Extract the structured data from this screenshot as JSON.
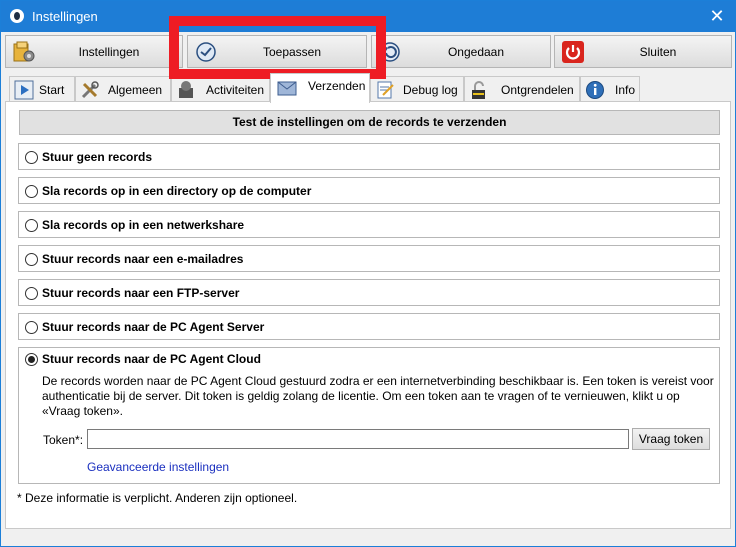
{
  "window": {
    "title": "Instellingen",
    "close_glyph": "✕"
  },
  "toolbar": [
    {
      "id": "settings",
      "label": "Instellingen",
      "icon": "settings-folder-icon"
    },
    {
      "id": "apply",
      "label": "Toepassen",
      "icon": "apply-check-icon"
    },
    {
      "id": "undo",
      "label": "Ongedaan",
      "icon": "undo-icon"
    },
    {
      "id": "close",
      "label": "Sluiten",
      "icon": "power-icon"
    }
  ],
  "tabs": [
    {
      "label": "Start",
      "icon": "play-icon",
      "active": false
    },
    {
      "label": "Algemeen",
      "icon": "tools-icon",
      "active": false
    },
    {
      "label": "Activiteiten",
      "icon": "activity-icon",
      "active": false
    },
    {
      "label": "Verzenden",
      "icon": "envelope-icon",
      "active": true
    },
    {
      "label": "Debug log",
      "icon": "notepad-icon",
      "active": false
    },
    {
      "label": "Ontgrendelen",
      "icon": "unlock-icon",
      "active": false
    },
    {
      "label": "Info",
      "icon": "info-icon",
      "active": false
    }
  ],
  "panel": {
    "header": "Test de instellingen om de records te verzenden",
    "options": [
      {
        "label": "Stuur geen records",
        "selected": false
      },
      {
        "label": "Sla records op in een directory op de computer",
        "selected": false
      },
      {
        "label": "Sla records op in een netwerkshare",
        "selected": false
      },
      {
        "label": "Stuur records naar een e-mailadres",
        "selected": false
      },
      {
        "label": "Stuur records naar een FTP-server",
        "selected": false
      },
      {
        "label": "Stuur records naar de PC Agent Server",
        "selected": false
      }
    ],
    "cloud": {
      "label": "Stuur records naar de PC Agent Cloud",
      "selected": true,
      "description": "De records worden naar de PC Agent Cloud gestuurd zodra er een internetverbinding beschikbaar is. Een token is vereist voor authenticatie bij de server. Dit token is geldig zolang de licentie. Om een token aan te vragen of te vernieuwen, klikt u op «Vraag token».",
      "token_label": "Token*:",
      "token_value": "",
      "token_button": "Vraag token",
      "advanced_link": "Geavanceerde instellingen"
    },
    "footnote": "* Deze informatie is verplicht. Anderen zijn optioneel."
  },
  "colors": {
    "titlebar": "#1e7dd6",
    "highlight": "#ee1c24",
    "link": "#1a2fbf"
  }
}
